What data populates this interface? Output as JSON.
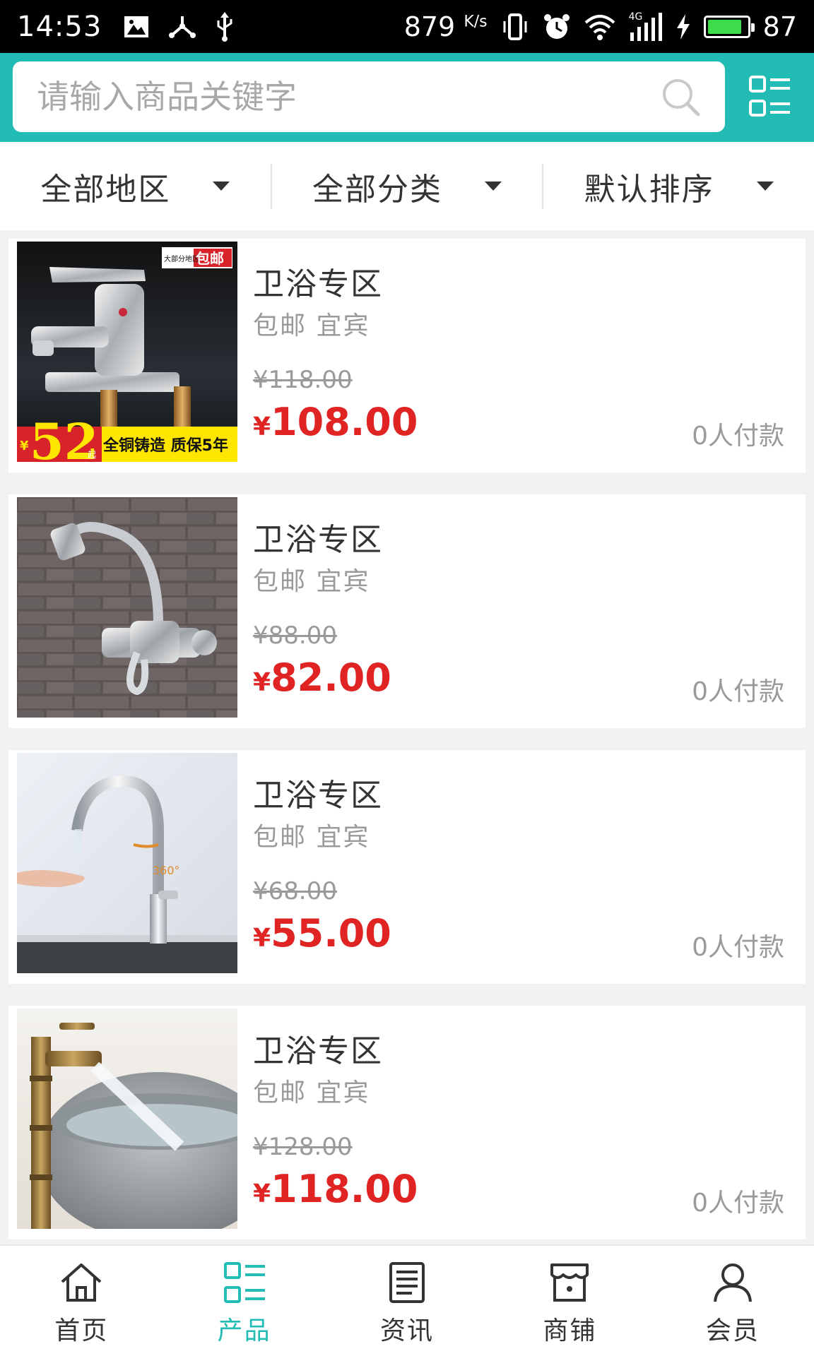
{
  "status_bar": {
    "time": "14:53",
    "network_speed": "879",
    "network_unit": "K/s",
    "signal_label": "4G",
    "battery_level": "87"
  },
  "search": {
    "placeholder": "请输入商品关键字"
  },
  "filters": [
    {
      "label": "全部地区"
    },
    {
      "label": "全部分类"
    },
    {
      "label": "默认排序"
    }
  ],
  "products": [
    {
      "title": "卫浴专区",
      "tags": "包邮 宜宾",
      "old_price": "¥118.00",
      "price_symbol": "¥",
      "price": "108.00",
      "sales": "0人付款",
      "image_badge_top": "大部分地区",
      "image_badge_free": "包邮",
      "image_price_big": "52",
      "image_price_unit": "起",
      "image_caption": "全铜铸造 质保5年"
    },
    {
      "title": "卫浴专区",
      "tags": "包邮 宜宾",
      "old_price": "¥88.00",
      "price_symbol": "¥",
      "price": "82.00",
      "sales": "0人付款"
    },
    {
      "title": "卫浴专区",
      "tags": "包邮 宜宾",
      "old_price": "¥68.00",
      "price_symbol": "¥",
      "price": "55.00",
      "sales": "0人付款",
      "image_rotation_label": "360°"
    },
    {
      "title": "卫浴专区",
      "tags": "包邮 宜宾",
      "old_price": "¥128.00",
      "price_symbol": "¥",
      "price": "118.00",
      "sales": "0人付款"
    }
  ],
  "bottom_nav": [
    {
      "label": "首页",
      "icon": "home-icon"
    },
    {
      "label": "产品",
      "icon": "product-grid-icon",
      "active": true
    },
    {
      "label": "资讯",
      "icon": "news-icon"
    },
    {
      "label": "商铺",
      "icon": "store-icon"
    },
    {
      "label": "会员",
      "icon": "user-icon"
    }
  ],
  "colors": {
    "accent": "#22bcb4",
    "price_red": "#e02424",
    "muted_text": "#9a9a9a"
  }
}
